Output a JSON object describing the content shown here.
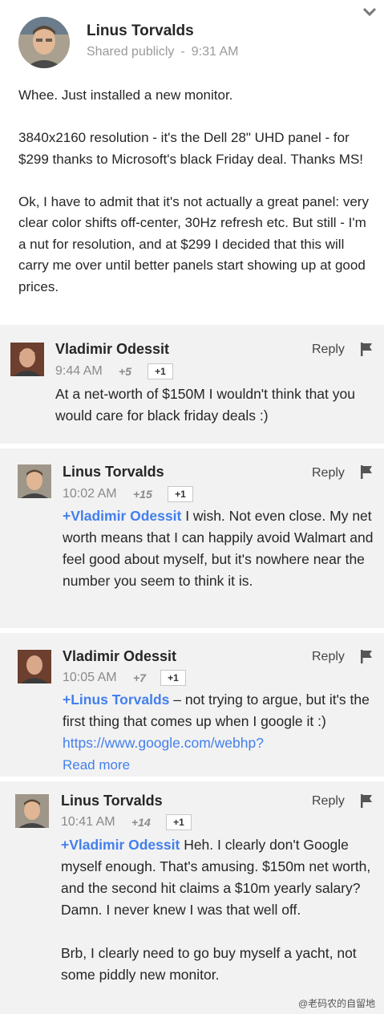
{
  "post": {
    "author": "Linus Torvalds",
    "visibility": "Shared publicly",
    "separator": "-",
    "time": "9:31 AM",
    "paragraphs": [
      "Whee. Just installed a new monitor.",
      "3840x2160 resolution - it's the Dell 28\" UHD panel - for $299 thanks to Microsoft's black Friday deal. Thanks MS!",
      "Ok, I have to admit that it's not actually a great panel: very clear color shifts off-center, 30Hz refresh etc. But still - I'm a nut for resolution, and at $299 I decided that this will carry me over until better panels start showing up at good prices."
    ]
  },
  "comments": [
    {
      "author": "Vladimir Odessit",
      "time": "9:44 AM",
      "plus_count": "+5",
      "plusone_label": "+1",
      "reply_label": "Reply",
      "text": "At a net-worth of $150M I wouldn't think that you would care for black friday deals :)"
    },
    {
      "author": "Linus Torvalds",
      "time": "10:02 AM",
      "plus_count": "+15",
      "plusone_label": "+1",
      "reply_label": "Reply",
      "mention": "+Vladimir Odessit",
      "text": " I wish. Not even close. My net worth means that I can happily avoid Walmart and feel good about myself, but it's nowhere near the number you seem to think it is."
    },
    {
      "author": "Vladimir Odessit",
      "time": "10:05 AM",
      "plus_count": "+7",
      "plusone_label": "+1",
      "reply_label": "Reply",
      "mention": "+Linus Torvalds",
      "text": " – not trying to argue, but it's the first thing that comes up when I google it :) ",
      "link": "https://www.google.com/webhp?",
      "read_more": "Read more"
    },
    {
      "author": "Linus Torvalds",
      "time": "10:41 AM",
      "plus_count": "+14",
      "plusone_label": "+1",
      "reply_label": "Reply",
      "mention": "+Vladimir Odessit",
      "text": " Heh. I clearly don't Google myself enough. That's amusing. $150m net worth, and the second hit claims a $10m yearly salary? Damn. I never knew I was that well off.",
      "text2": "Brb, I clearly need to go buy myself a yacht, not some piddly new monitor."
    }
  ],
  "watermark": "@老码农的自留地",
  "colors": {
    "accent": "#427fed",
    "comment_bg": "#f2f2f2"
  }
}
